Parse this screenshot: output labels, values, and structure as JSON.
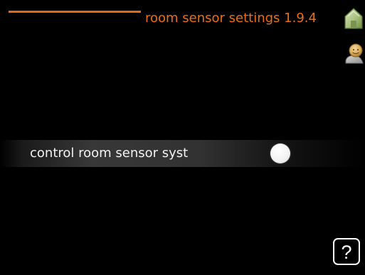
{
  "header": {
    "title": "room sensor settings 1.9.4",
    "accent_color": "#e86f16"
  },
  "side_icons": [
    {
      "name": "home-icon"
    },
    {
      "name": "user-icon"
    }
  ],
  "setting_row": {
    "label": "control room sensor syst",
    "toggle_state": "off"
  },
  "help": {
    "label": "?"
  }
}
